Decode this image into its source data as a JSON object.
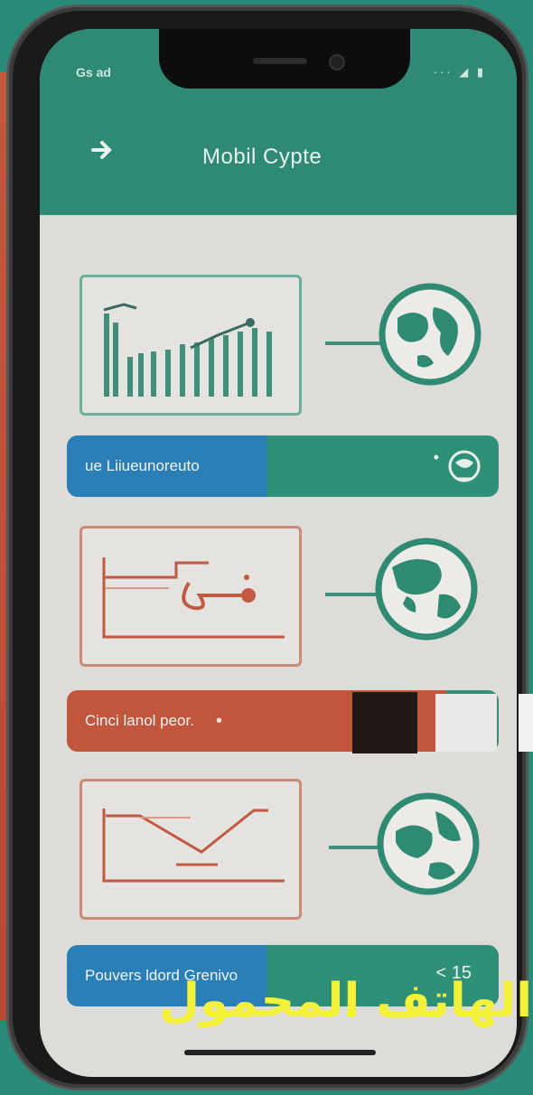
{
  "header": {
    "title": "Mobil Cypte",
    "status_time": "Gs ad",
    "status_icons": "··· ◢ ▮"
  },
  "cards": [
    {
      "banner_label": "ue Liiueunoreuto",
      "banner_icon": "globe-badge-icon"
    },
    {
      "banner_label": "Cinci lanol peor.",
      "banner_icon": "dot-icon"
    },
    {
      "banner_label": "Pouvers ldord Grenivo",
      "banner_icon": "chevron-left-icon",
      "banner_extra": "< 15"
    }
  ],
  "overlay_caption": "الهاتف المحمول",
  "colors": {
    "brand_green": "#2e8a75",
    "banner_blue": "#2a7fb6",
    "banner_red": "#c2563c",
    "caption_yellow": "#f3f13a"
  }
}
